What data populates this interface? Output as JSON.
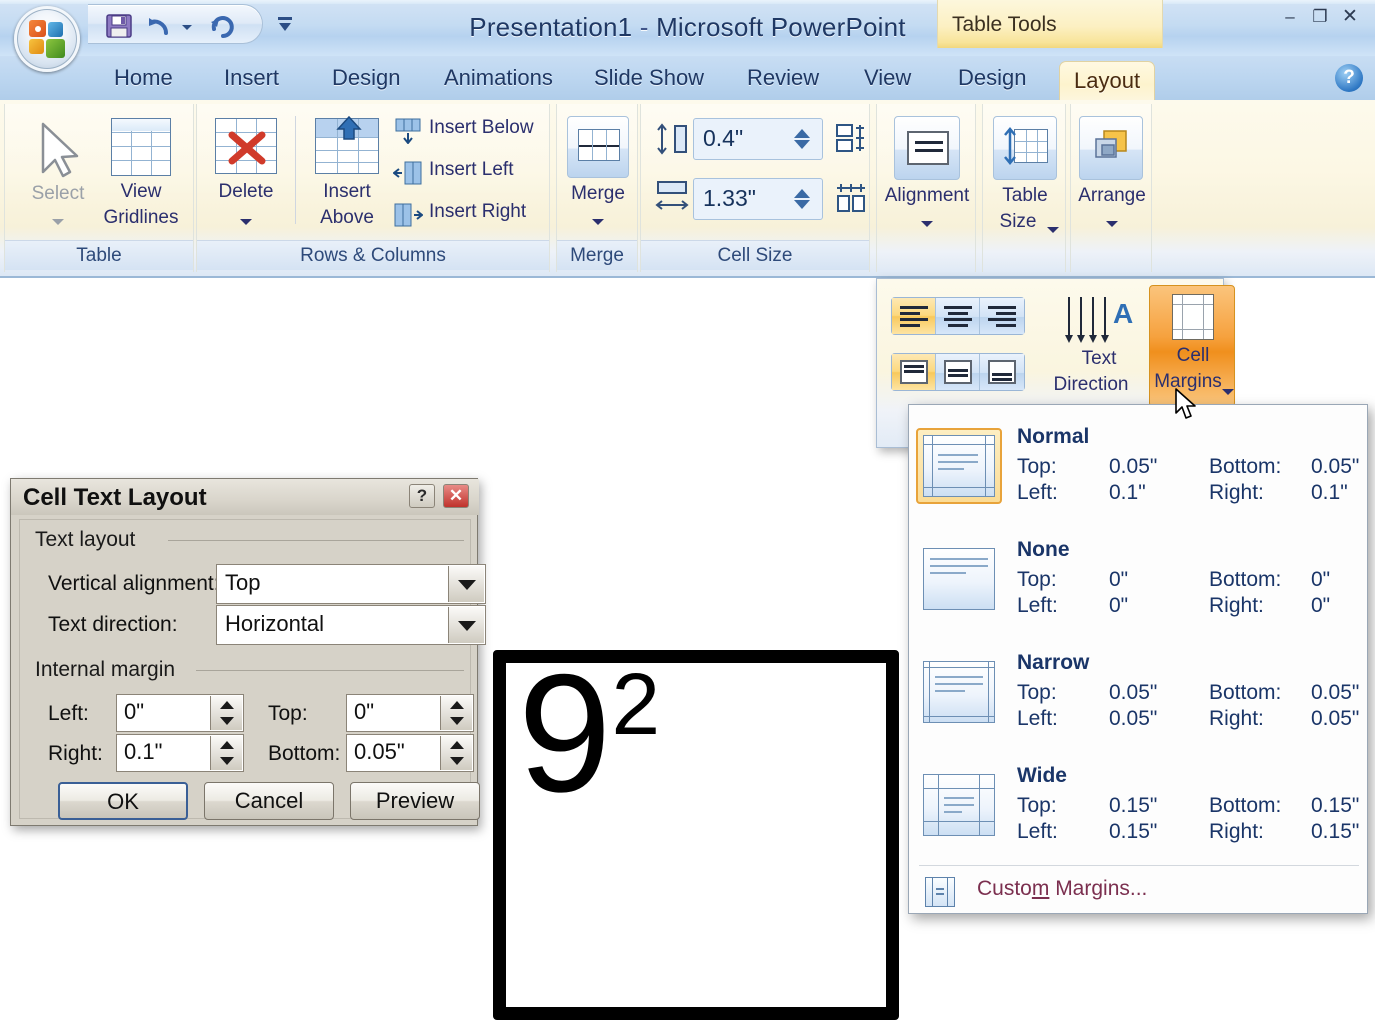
{
  "window": {
    "title_doc": "Presentation1",
    "title_sep": "-",
    "title_app": "Microsoft PowerPoint",
    "contextual_tab_banner": "Table Tools",
    "minimize": "–",
    "maximize": "❐",
    "close": "✕",
    "help": "?"
  },
  "quick_access": {
    "save": "save-icon",
    "undo": "undo-icon",
    "undo_dropdown": "chevron-down-icon",
    "redo": "redo-icon",
    "customize": "customize-qat-icon"
  },
  "tabs": [
    {
      "label": "Home",
      "active": false
    },
    {
      "label": "Insert",
      "active": false
    },
    {
      "label": "Design",
      "active": false
    },
    {
      "label": "Animations",
      "active": false
    },
    {
      "label": "Slide Show",
      "active": false
    },
    {
      "label": "Review",
      "active": false
    },
    {
      "label": "View",
      "active": false
    },
    {
      "label": "Design",
      "active": false
    },
    {
      "label": "Layout",
      "active": true
    }
  ],
  "ribbon": {
    "groups": [
      {
        "label": "Table"
      },
      {
        "label": "Rows & Columns"
      },
      {
        "label": "Merge"
      },
      {
        "label": "Cell Size"
      }
    ],
    "table_group": {
      "select": "Select",
      "view_gridlines_line1": "View",
      "view_gridlines_line2": "Gridlines"
    },
    "rows_columns_group": {
      "delete": "Delete",
      "insert_above_line1": "Insert",
      "insert_above_line2": "Above",
      "insert_below": "Insert Below",
      "insert_left": "Insert Left",
      "insert_right": "Insert Right"
    },
    "merge_group": {
      "merge": "Merge"
    },
    "cell_size_group": {
      "height_value": "0.4\"",
      "width_value": "1.33\"",
      "distribute_rows": "distribute-rows-icon",
      "distribute_columns": "distribute-columns-icon"
    },
    "alignment_group": {
      "label": "Alignment"
    },
    "table_size_group": {
      "line1": "Table",
      "line2": "Size"
    },
    "arrange_group": {
      "label": "Arrange"
    }
  },
  "alignment_panel": {
    "align_left": "align-left",
    "align_center": "align-center",
    "align_right": "align-right",
    "align_top": "align-top",
    "align_middle": "align-middle",
    "align_bottom": "align-bottom",
    "text_direction_line1": "Text",
    "text_direction_line2": "Direction",
    "cell_margins_line1": "Cell",
    "cell_margins_line2": "Margins"
  },
  "cell_margins_menu": {
    "items": [
      {
        "name": "Normal",
        "selected": true,
        "top_label": "Top:",
        "top_value": "0.05\"",
        "bottom_label": "Bottom:",
        "bottom_value": "0.05\"",
        "left_label": "Left:",
        "left_value": "0.1\"",
        "right_label": "Right:",
        "right_value": "0.1\""
      },
      {
        "name": "None",
        "selected": false,
        "top_label": "Top:",
        "top_value": "0\"",
        "bottom_label": "Bottom:",
        "bottom_value": "0\"",
        "left_label": "Left:",
        "left_value": "0\"",
        "right_label": "Right:",
        "right_value": "0\""
      },
      {
        "name": "Narrow",
        "selected": false,
        "top_label": "Top:",
        "top_value": "0.05\"",
        "bottom_label": "Bottom:",
        "bottom_value": "0.05\"",
        "left_label": "Left:",
        "left_value": "0.05\"",
        "right_label": "Right:",
        "right_value": "0.05\""
      },
      {
        "name": "Wide",
        "selected": false,
        "top_label": "Top:",
        "top_value": "0.15\"",
        "bottom_label": "Bottom:",
        "bottom_value": "0.15\"",
        "left_label": "Left:",
        "left_value": "0.15\"",
        "right_label": "Right:",
        "right_value": "0.15\""
      }
    ],
    "custom_margins_pre": "Custo",
    "custom_margins_accel": "m",
    "custom_margins_post": " Margins..."
  },
  "dialog": {
    "title": "Cell Text Layout",
    "help_btn": "?",
    "close_btn": "✕",
    "group_text_layout": "Text layout",
    "group_internal_margin": "Internal margin",
    "vertical_alignment_pre": "V",
    "vertical_alignment_accel": "",
    "vertical_alignment_label": "Vertical alignment:",
    "vertical_alignment_value": "Top",
    "text_direction_label": "Text direction:",
    "text_direction_value": "Horizontal",
    "left_label": "Left:",
    "left_value": "0\"",
    "top_label": "Top:",
    "top_value": "0\"",
    "right_label": "Right:",
    "right_value": "0.1\"",
    "bottom_label": "Bottom:",
    "bottom_value": "0.05\"",
    "ok": "OK",
    "cancel": "Cancel",
    "preview": "Preview"
  },
  "slide": {
    "cell_base": "9",
    "cell_exponent": "2"
  },
  "colors": {
    "accent_orange": "#f29a22",
    "ribbon_cream": "#fdfaec",
    "title_blue": "#1f3864",
    "menu_text": "#1a3568",
    "dialog_face": "#d6d2c8"
  }
}
